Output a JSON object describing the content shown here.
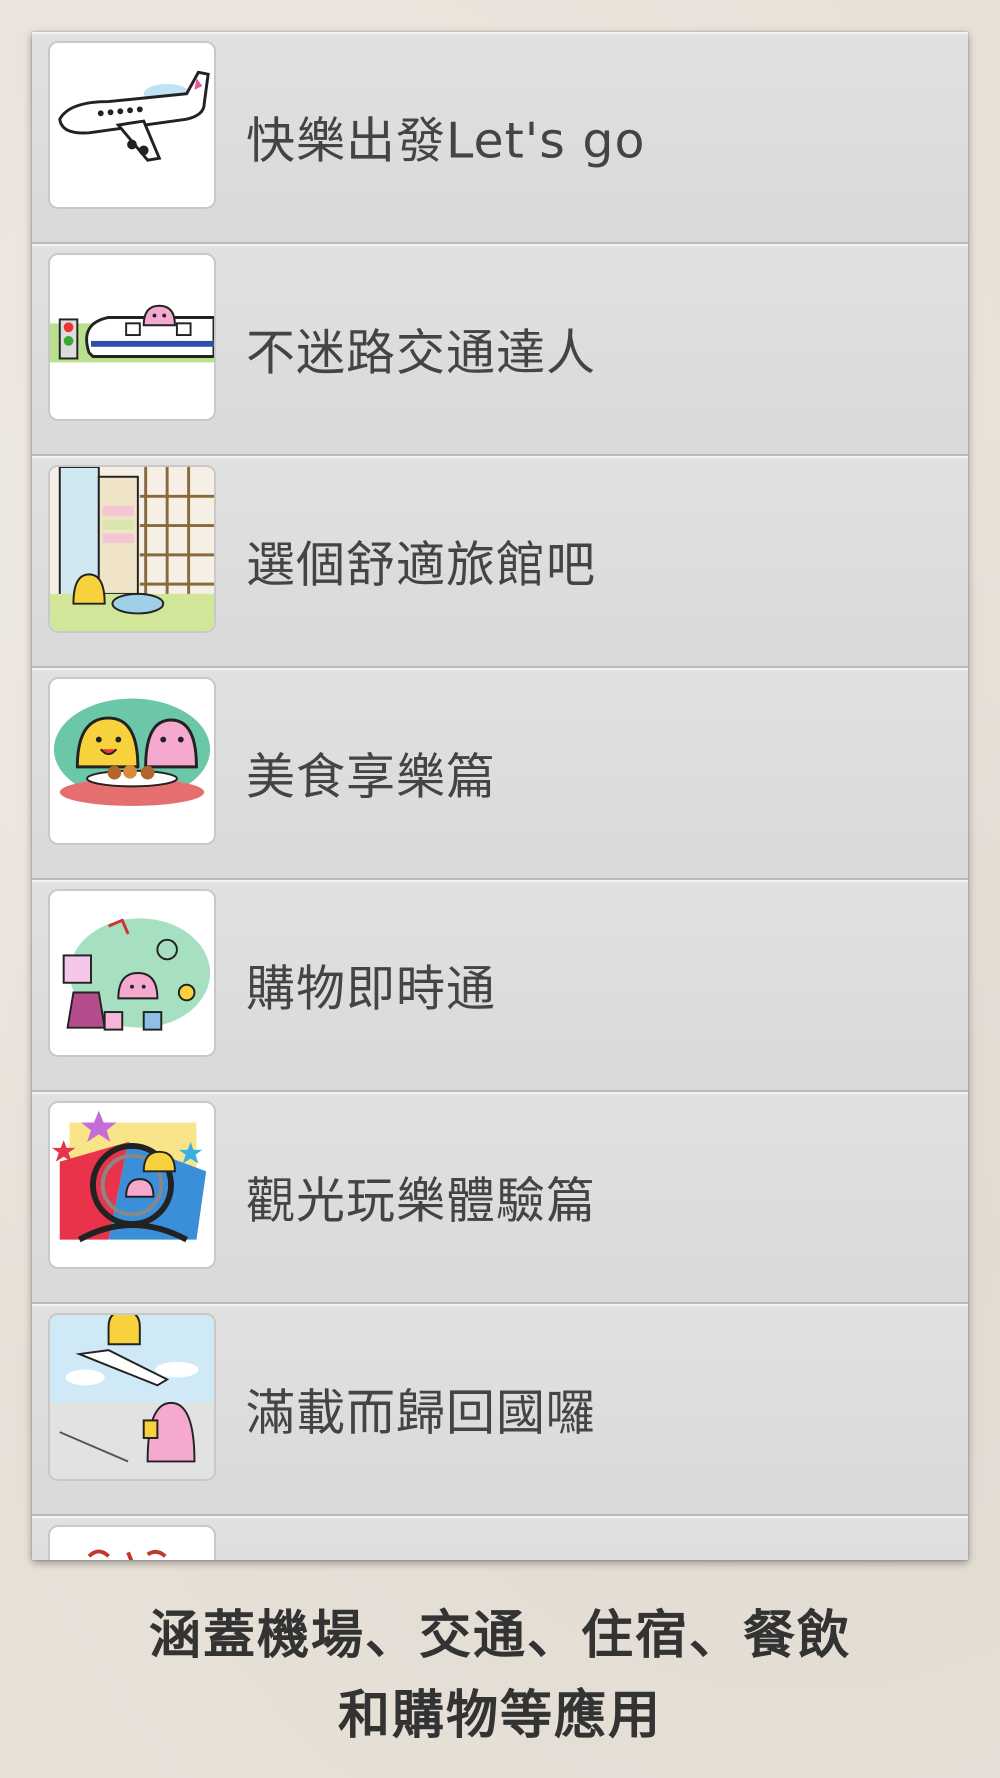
{
  "list": {
    "items": [
      {
        "label": "快樂出發Let's go",
        "icon": "airplane-icon"
      },
      {
        "label": "不迷路交通達人",
        "icon": "train-icon"
      },
      {
        "label": "選個舒適旅館吧",
        "icon": "hotel-room-icon"
      },
      {
        "label": "美食享樂篇",
        "icon": "food-icon"
      },
      {
        "label": "購物即時通",
        "icon": "shopping-icon"
      },
      {
        "label": "觀光玩樂體驗篇",
        "icon": "rollercoaster-icon"
      },
      {
        "label": "滿載而歸回國囉",
        "icon": "airport-return-icon"
      },
      {
        "label": "",
        "icon": "partial-thumbnail-icon"
      }
    ]
  },
  "caption": {
    "line1": "涵蓋機場、交通、住宿、餐飲",
    "line2": "和購物等應用"
  },
  "colors": {
    "background": "#e8e1d8",
    "row": "#dcdcdc",
    "text": "#444444"
  }
}
